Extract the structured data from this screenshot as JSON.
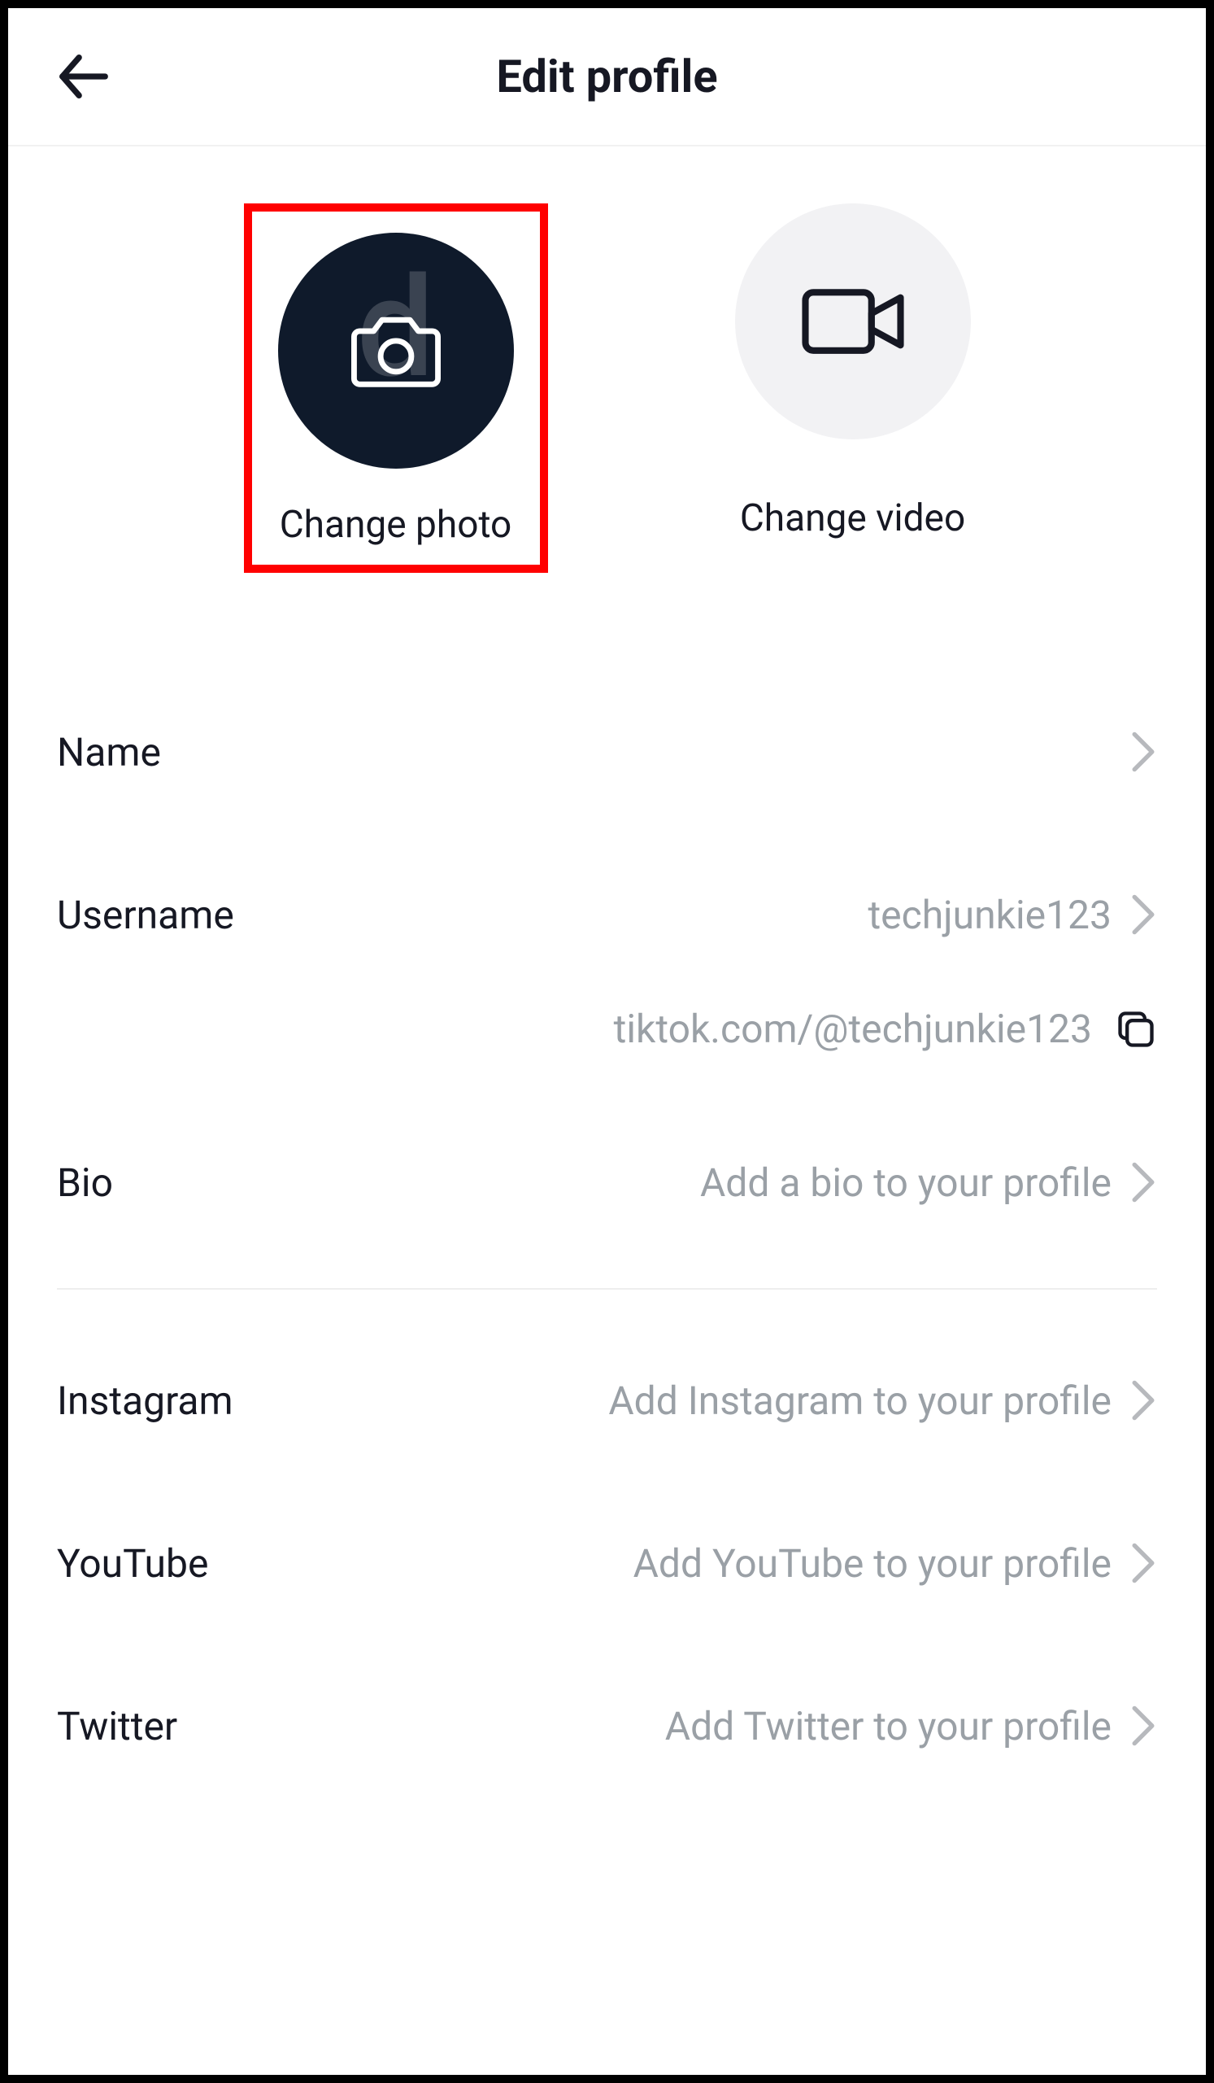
{
  "header": {
    "title": "Edit profile"
  },
  "media": {
    "photo_label": "Change photo",
    "video_label": "Change video"
  },
  "fields": {
    "name": {
      "label": "Name",
      "value": ""
    },
    "username": {
      "label": "Username",
      "value": "techjunkie123"
    },
    "profile_url": "tiktok.com/@techjunkie123",
    "bio": {
      "label": "Bio",
      "placeholder": "Add a bio to your profile"
    }
  },
  "socials": {
    "instagram": {
      "label": "Instagram",
      "placeholder": "Add Instagram to your profile"
    },
    "youtube": {
      "label": "YouTube",
      "placeholder": "Add YouTube to your profile"
    },
    "twitter": {
      "label": "Twitter",
      "placeholder": "Add Twitter to your profile"
    }
  }
}
